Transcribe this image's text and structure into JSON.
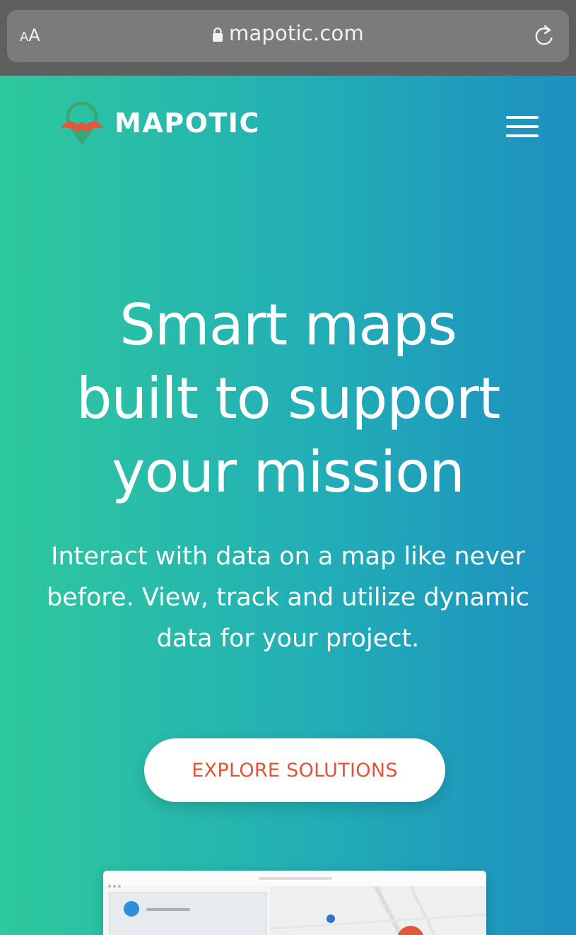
{
  "browser": {
    "text_size_label_small": "A",
    "text_size_label_large": "A",
    "url": "mapotic.com",
    "lock_icon": "lock-icon",
    "reload_icon": "reload-icon"
  },
  "header": {
    "logo_icon": "mapotic-logo-icon",
    "brand": "MAPOTIC",
    "menu_icon": "hamburger-menu-icon"
  },
  "hero": {
    "title_lines": [
      "Smart maps",
      "built to support",
      "your mission"
    ],
    "subtitle_lines": [
      "Interact with data on a map like never",
      "before. View, track and utilize dynamic",
      "data for your project."
    ],
    "cta_label": "EXPLORE SOLUTIONS"
  },
  "colors": {
    "gradient_start": "#2ec99d",
    "gradient_end": "#1d8fc0",
    "cta_text": "#e0553a",
    "logo_mustache": "#e2563b",
    "logo_pin": "#3aa776"
  }
}
